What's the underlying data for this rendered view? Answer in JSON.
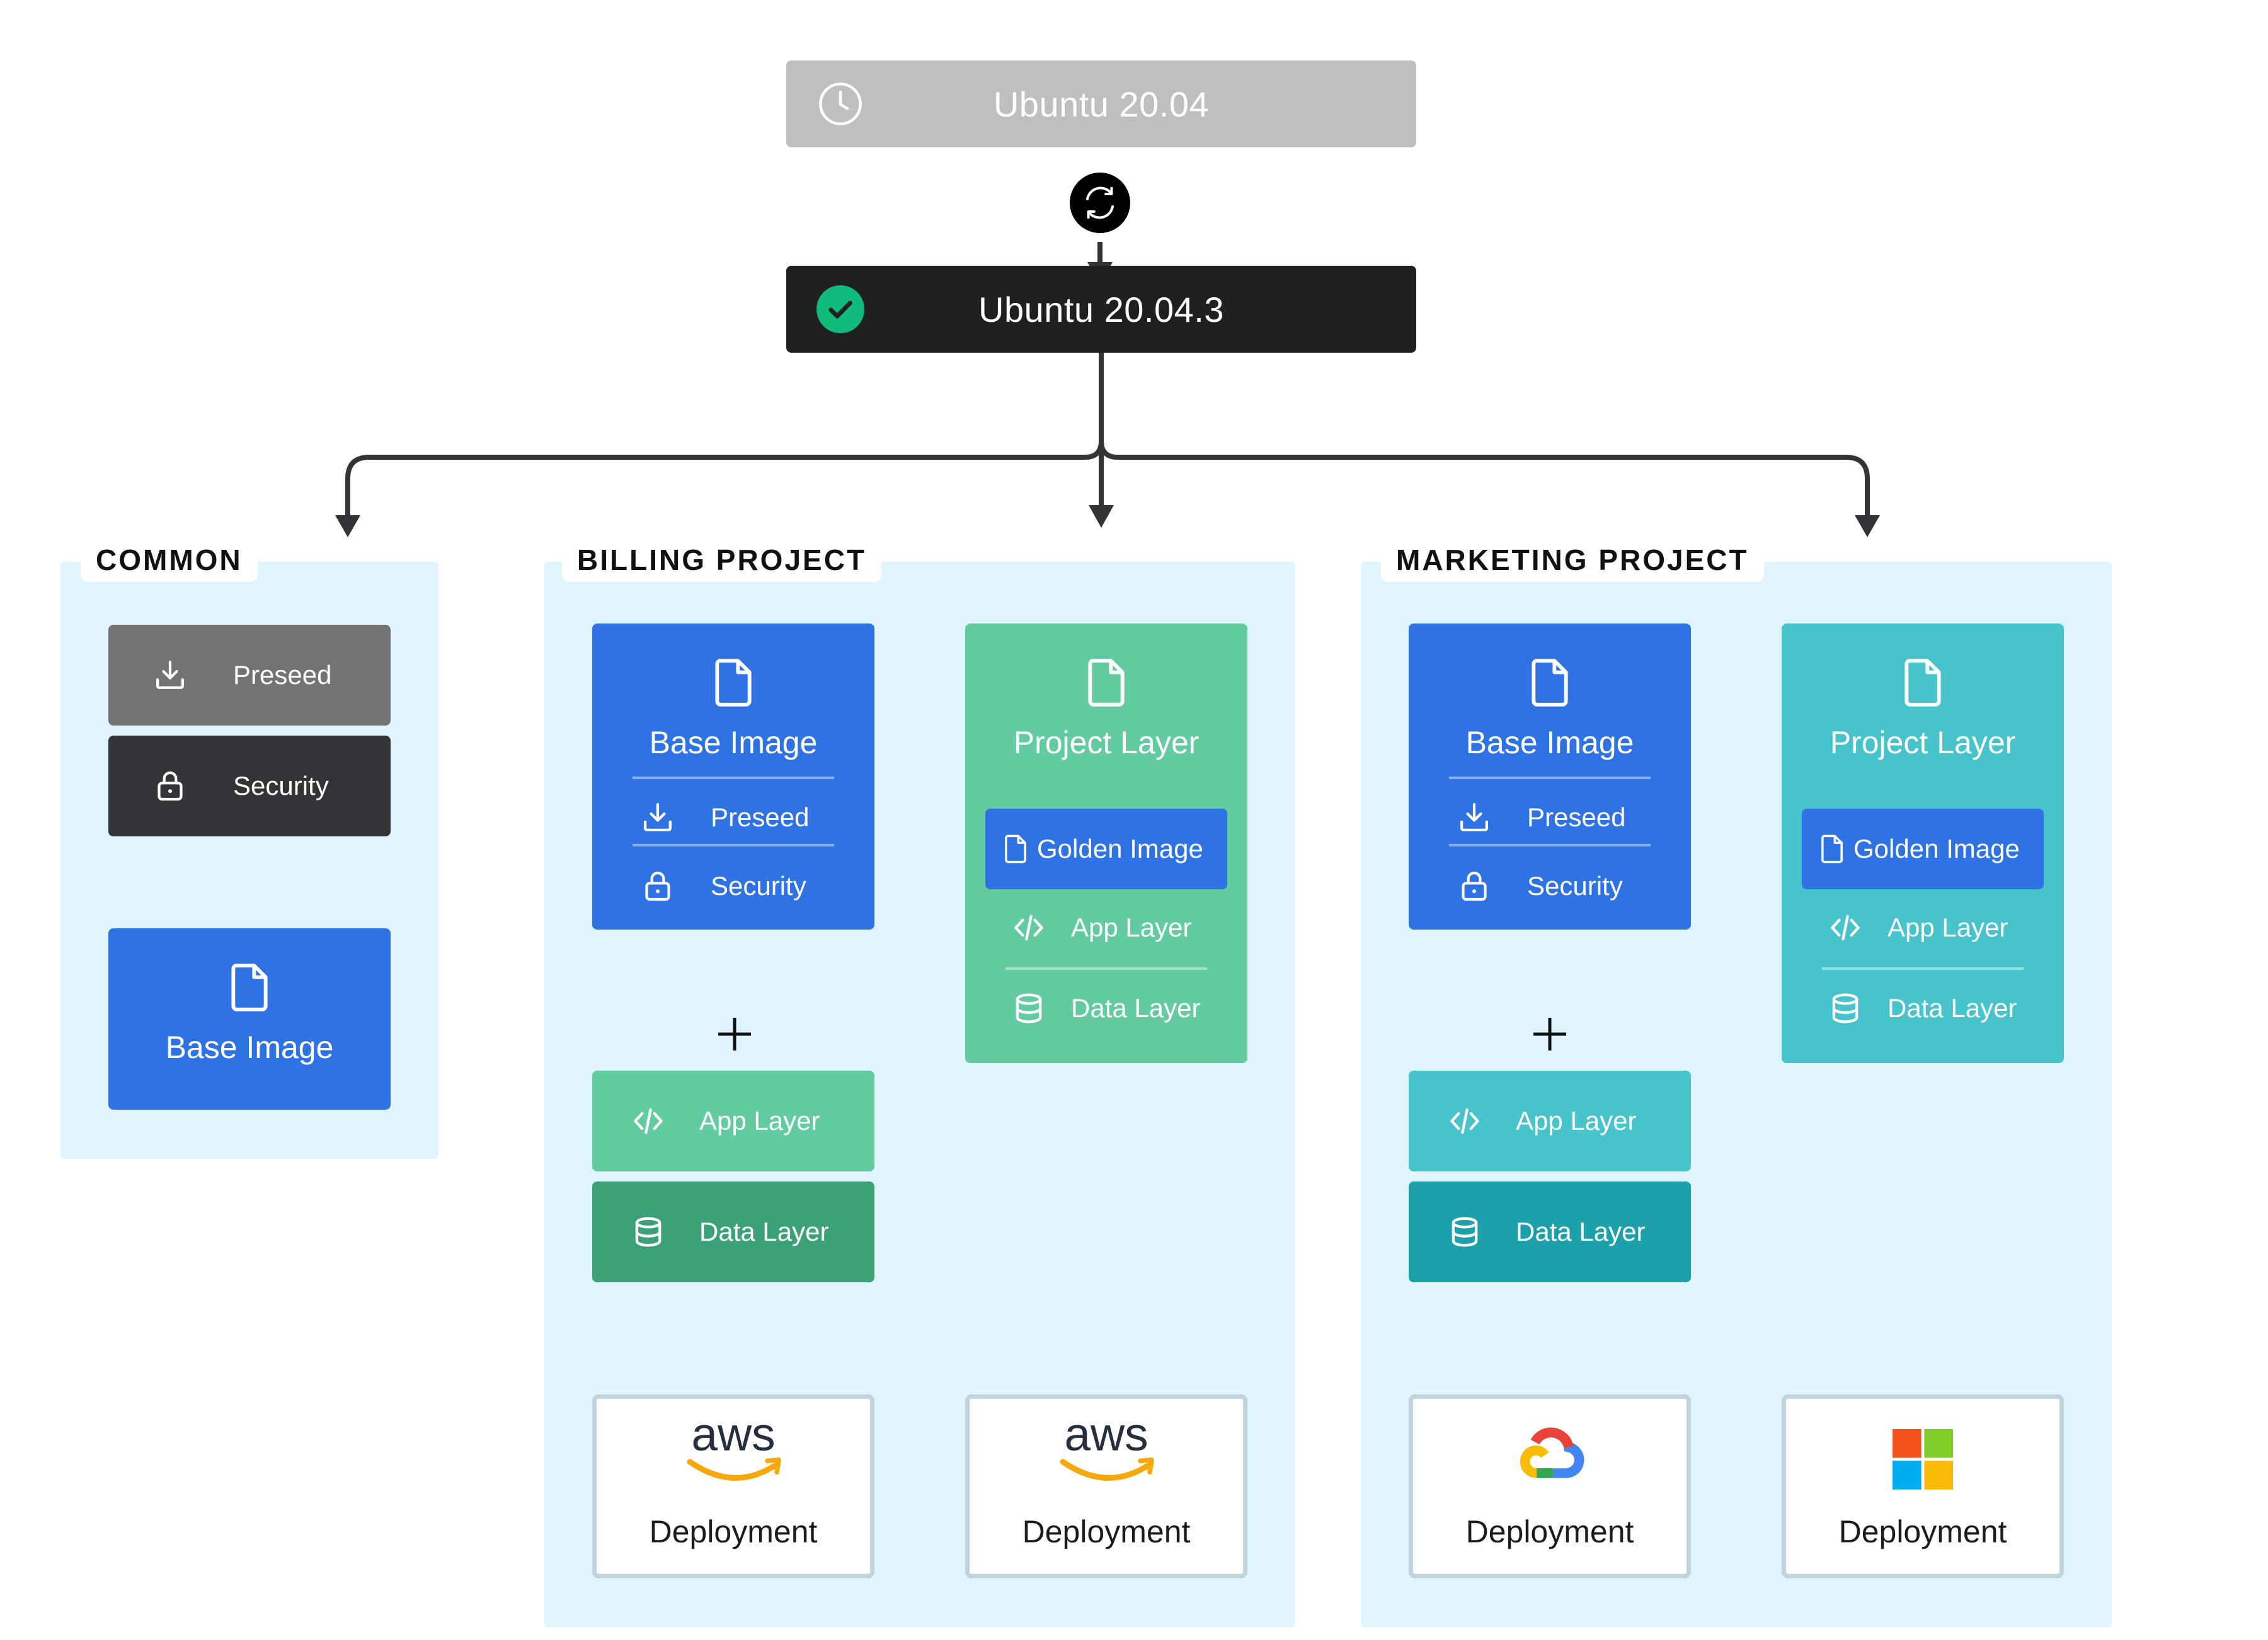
{
  "colors": {
    "top_pending": "#bfbfbf",
    "top_current": "#1f2022",
    "status_ok": "#10bc7b",
    "refresh_bg": "#000000",
    "panel_bg": "#e0f4fd",
    "blue": "#2f72e3",
    "gray_preseed": "#737375",
    "dark_security": "#333437",
    "billing_green": "#62cba0",
    "billing_green_dark": "#3ba177",
    "marketing_teal": "#46c3cb",
    "marketing_teal_dark": "#1ca0a9",
    "connector": "#333437",
    "deploy_border": "#c0d4dc"
  },
  "top": {
    "pending": {
      "label": "Ubuntu 20.04",
      "icon": "clock-icon"
    },
    "update_icon": "refresh-icon",
    "current": {
      "label": "Ubuntu 20.04.3",
      "icon": "check-circle-icon"
    }
  },
  "sections": {
    "common": {
      "title": "COMMON",
      "preseed": "Preseed",
      "security": "Security",
      "base_image": "Base Image"
    },
    "billing": {
      "title": "BILLING PROJECT",
      "base_image": {
        "title": "Base Image",
        "items": [
          "Preseed",
          "Security"
        ]
      },
      "project_layer": {
        "title": "Project Layer",
        "golden": "Golden Image",
        "items": [
          "App Layer",
          "Data Layer"
        ]
      },
      "plus": "+",
      "app_layer": "App Layer",
      "data_layer": "Data Layer",
      "deployments": [
        {
          "provider": "aws",
          "logo_text": "aws",
          "label": "Deployment"
        },
        {
          "provider": "aws",
          "logo_text": "aws",
          "label": "Deployment"
        }
      ]
    },
    "marketing": {
      "title": "MARKETING PROJECT",
      "base_image": {
        "title": "Base Image",
        "items": [
          "Preseed",
          "Security"
        ]
      },
      "project_layer": {
        "title": "Project Layer",
        "golden": "Golden Image",
        "items": [
          "App Layer",
          "Data Layer"
        ]
      },
      "plus": "+",
      "app_layer": "App Layer",
      "data_layer": "Data Layer",
      "deployments": [
        {
          "provider": "google-cloud",
          "label": "Deployment"
        },
        {
          "provider": "microsoft-azure",
          "label": "Deployment"
        }
      ]
    }
  }
}
